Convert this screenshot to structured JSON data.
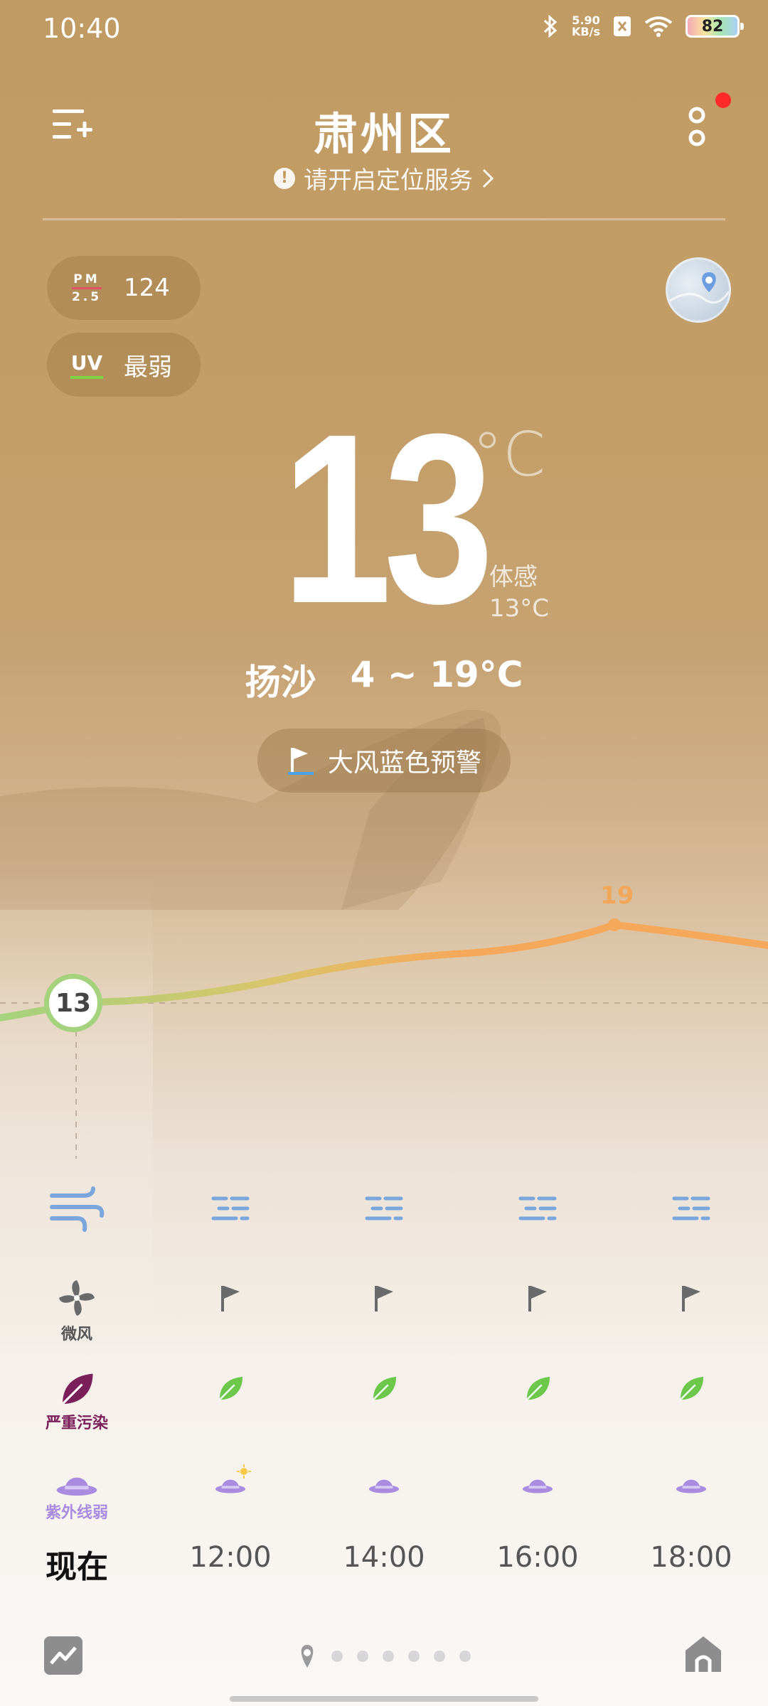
{
  "status_bar": {
    "time": "10:40",
    "net_speed_value": "5.90",
    "net_speed_unit": "KB/s",
    "battery": "82",
    "icons": [
      "bluetooth-icon",
      "no-sim-icon",
      "wifi-icon",
      "battery-icon"
    ]
  },
  "header": {
    "city": "肃州区",
    "location_hint": "请开启定位服务",
    "has_notification": true
  },
  "air": {
    "pm_top": "PM",
    "pm_bottom": "2.5",
    "pm_value": "124",
    "uv_label": "UV",
    "uv_value": "最弱"
  },
  "current": {
    "temperature": "13",
    "unit": "°C",
    "feels_label": "体感",
    "feels_value": "13°C",
    "condition": "扬沙",
    "range": "4 ~ 19°C",
    "warning": "大风蓝色预警"
  },
  "chart_data": {
    "type": "line",
    "x": [
      "现在",
      "12:00",
      "14:00",
      "16:00",
      "18:00"
    ],
    "series": [
      {
        "values": [
          13,
          14,
          16,
          17,
          18
        ]
      }
    ],
    "now_label": "13",
    "peak_label": "19",
    "peak_value": 19
  },
  "hourly": {
    "times": [
      "现在",
      "12:00",
      "14:00",
      "16:00",
      "18:00"
    ],
    "wind_label_now": "微风",
    "aqi_label_now": "严重污染",
    "uv_label_now": "紫外线弱",
    "colors": {
      "weather_icon": "#7aa6dc",
      "wind_icon": "#6a6a6a",
      "aqi_severe": "#7a1f5a",
      "aqi_good": "#6cc84a",
      "uv_icon": "#a98be0",
      "chart_start": "#a5d27d",
      "chart_end": "#f6a85a"
    }
  },
  "bottom": {
    "page_count": 7,
    "active_page": 0
  }
}
